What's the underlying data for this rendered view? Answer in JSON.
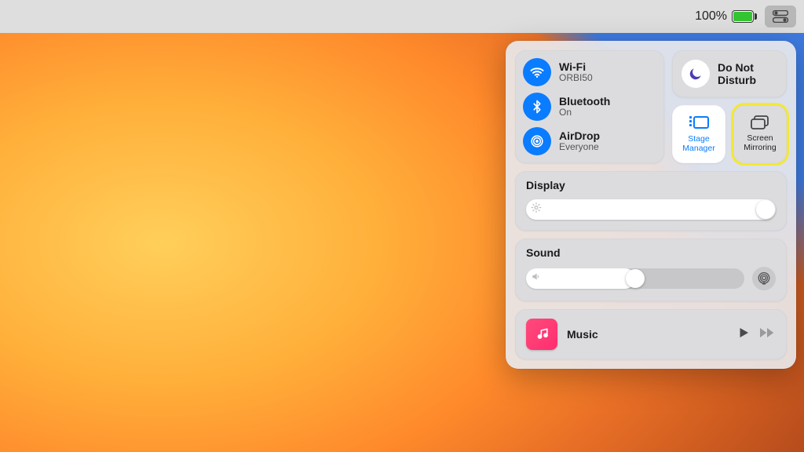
{
  "menubar": {
    "battery_percent": "100%"
  },
  "control_center": {
    "connectivity": {
      "wifi": {
        "label": "Wi-Fi",
        "status": "ORBI50"
      },
      "bluetooth": {
        "label": "Bluetooth",
        "status": "On"
      },
      "airdrop": {
        "label": "AirDrop",
        "status": "Everyone"
      }
    },
    "dnd": {
      "label": "Do Not Disturb"
    },
    "tiles": {
      "stage_manager": {
        "label": "Stage Manager"
      },
      "screen_mirroring": {
        "label": "Screen Mirroring"
      }
    },
    "display": {
      "label": "Display",
      "brightness_pct": 100
    },
    "sound": {
      "label": "Sound",
      "volume_pct": 50
    },
    "now_playing": {
      "app_label": "Music"
    }
  },
  "colors": {
    "accent": "#0a7cff",
    "highlight": "#f4e836"
  }
}
